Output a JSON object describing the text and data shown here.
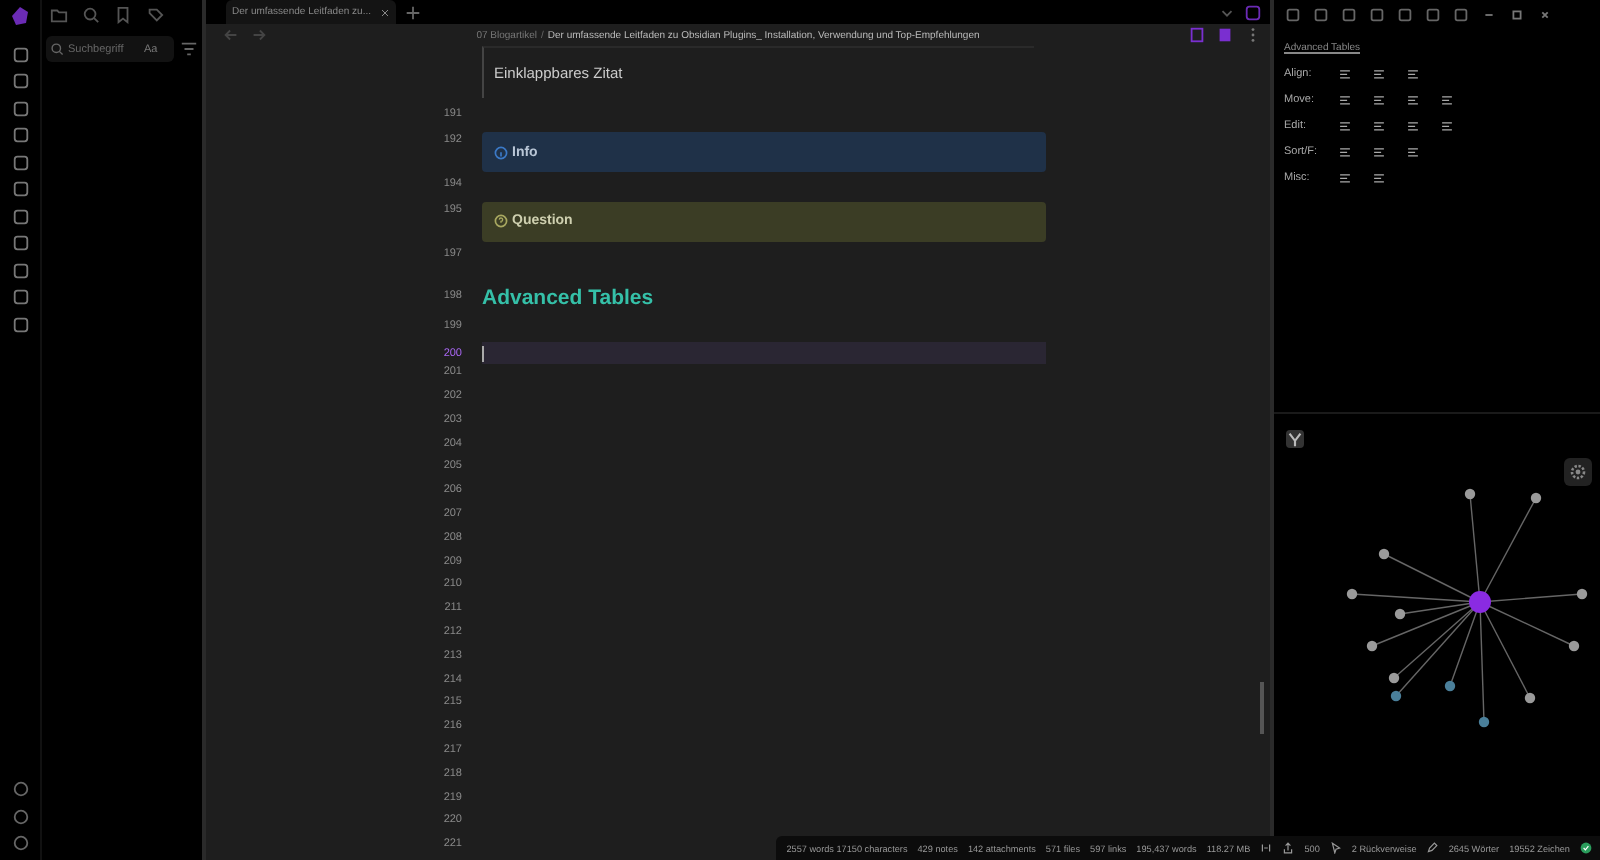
{
  "left_sidebar": {
    "search": {
      "placeholder": "Suchbegriff",
      "case_button": "Aa"
    }
  },
  "tabs": [
    {
      "label": "Der umfassende Leitfaden zu...",
      "selected": true
    }
  ],
  "breadcrumb": {
    "folder": "07 Blogartikel",
    "separator": "/",
    "title": "Der umfassende Leitfaden zu Obsidian Plugins_ Installation, Verwendung und Top-Empfehlungen"
  },
  "editor": {
    "quote": "Einklappbares Zitat",
    "lines": [
      {
        "number": "191",
        "kind": "blank",
        "active": false
      },
      {
        "number": "192",
        "kind": "info",
        "title": "Info",
        "active": false
      },
      {
        "number": "194",
        "kind": "blank",
        "active": false
      },
      {
        "number": "195",
        "kind": "question",
        "title": "Question",
        "active": false
      },
      {
        "number": "197",
        "kind": "blank",
        "active": false
      },
      {
        "number": "198",
        "kind": "heading",
        "text": "Advanced Tables",
        "active": false
      },
      {
        "number": "199",
        "kind": "blank",
        "active": false
      },
      {
        "number": "200",
        "kind": "blank",
        "active": true
      },
      {
        "number": "201",
        "kind": "blank",
        "active": false
      },
      {
        "number": "202",
        "kind": "blank",
        "active": false
      },
      {
        "number": "203",
        "kind": "blank",
        "active": false
      },
      {
        "number": "204",
        "kind": "blank",
        "active": false
      },
      {
        "number": "205",
        "kind": "blank",
        "active": false
      },
      {
        "number": "206",
        "kind": "blank",
        "active": false
      },
      {
        "number": "207",
        "kind": "blank",
        "active": false
      },
      {
        "number": "208",
        "kind": "blank",
        "active": false
      },
      {
        "number": "209",
        "kind": "blank",
        "active": false
      },
      {
        "number": "210",
        "kind": "blank",
        "active": false
      },
      {
        "number": "211",
        "kind": "blank",
        "active": false
      },
      {
        "number": "212",
        "kind": "blank",
        "active": false
      },
      {
        "number": "213",
        "kind": "blank",
        "active": false
      },
      {
        "number": "214",
        "kind": "blank",
        "active": false
      },
      {
        "number": "215",
        "kind": "blank",
        "active": false
      },
      {
        "number": "216",
        "kind": "blank",
        "active": false
      },
      {
        "number": "217",
        "kind": "blank",
        "active": false
      },
      {
        "number": "218",
        "kind": "blank",
        "active": false
      },
      {
        "number": "219",
        "kind": "blank",
        "active": false
      },
      {
        "number": "220",
        "kind": "blank",
        "active": false
      },
      {
        "number": "221",
        "kind": "blank",
        "active": false
      }
    ]
  },
  "right_panel": {
    "title": "Advanced Tables",
    "rows": [
      {
        "label": "Align:"
      },
      {
        "label": "Move:"
      },
      {
        "label": "Edit:"
      },
      {
        "label": "Sort/F:"
      },
      {
        "label": "Misc:"
      }
    ]
  },
  "status_bar": [
    "2557 words 17150 characters",
    "429 notes",
    "142 attachments",
    "571 files",
    "597 links",
    "195,437 words",
    "118.27 MB",
    "500",
    "2 Rückverweise",
    "2645 Wörter",
    "19552 Zeichen"
  ]
}
